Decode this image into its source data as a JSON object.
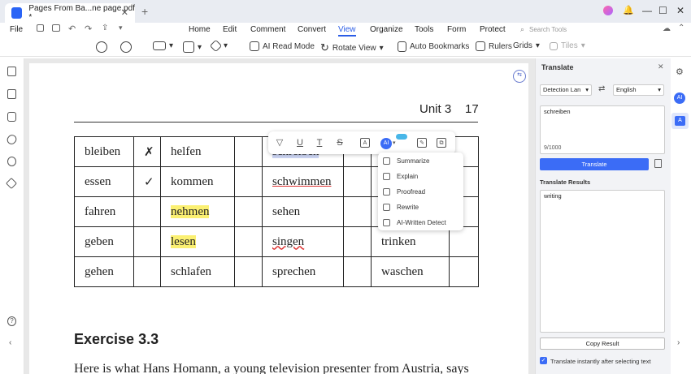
{
  "window": {
    "tab_title": "Pages From Ba...ne page.pdf *",
    "tab_close": "✕",
    "new_tab": "+",
    "minimize": "—",
    "maximize": "☐",
    "close": "✕"
  },
  "menubar": {
    "file": "File",
    "items": [
      "Home",
      "Edit",
      "Comment",
      "Convert",
      "View",
      "Organize",
      "Tools",
      "Form",
      "Protect"
    ],
    "active": "View",
    "search_placeholder": "Search Tools"
  },
  "toolbar": {
    "ai_read_mode": "AI Read Mode",
    "rotate_view": "Rotate View",
    "auto_bookmarks": "Auto Bookmarks",
    "rulers": "Rulers",
    "grids": "Grids",
    "tiles": "Tiles"
  },
  "document": {
    "unit": "Unit 3",
    "page_number": "17",
    "table": [
      [
        "bleiben",
        "✗",
        "helfen",
        "",
        "schreiben",
        "",
        "",
        ""
      ],
      [
        "essen",
        "✓",
        "kommen",
        "",
        "schwimmen",
        "",
        "",
        ""
      ],
      [
        "fahren",
        "",
        "nehmen",
        "",
        "sehen",
        "",
        "",
        ""
      ],
      [
        "geben",
        "",
        "lesen",
        "",
        "singen",
        "",
        "trinken",
        ""
      ],
      [
        "gehen",
        "",
        "schlafen",
        "",
        "sprechen",
        "",
        "waschen",
        ""
      ]
    ],
    "exercise_title": "Exercise 3.3",
    "paragraph": "Here is what Hans Homann, a young television presenter from Austria, says"
  },
  "float_toolbar": {
    "ai_label": "AI",
    "dropdown": [
      "Summarize",
      "Explain",
      "Proofread",
      "Rewrite",
      "AI-Written Detect"
    ]
  },
  "translate_panel": {
    "title": "Translate",
    "source_lang": "Detection Lan",
    "target_lang": "English",
    "swap": "⇄",
    "input_text": "schreiben",
    "char_count": "9/1000",
    "translate_btn": "Translate",
    "results_label": "Translate Results",
    "result_text": "writing",
    "copy_btn": "Copy Result",
    "instant_label": "Translate instantly after selecting text"
  },
  "right_rail": {
    "ai_label": "AI"
  }
}
